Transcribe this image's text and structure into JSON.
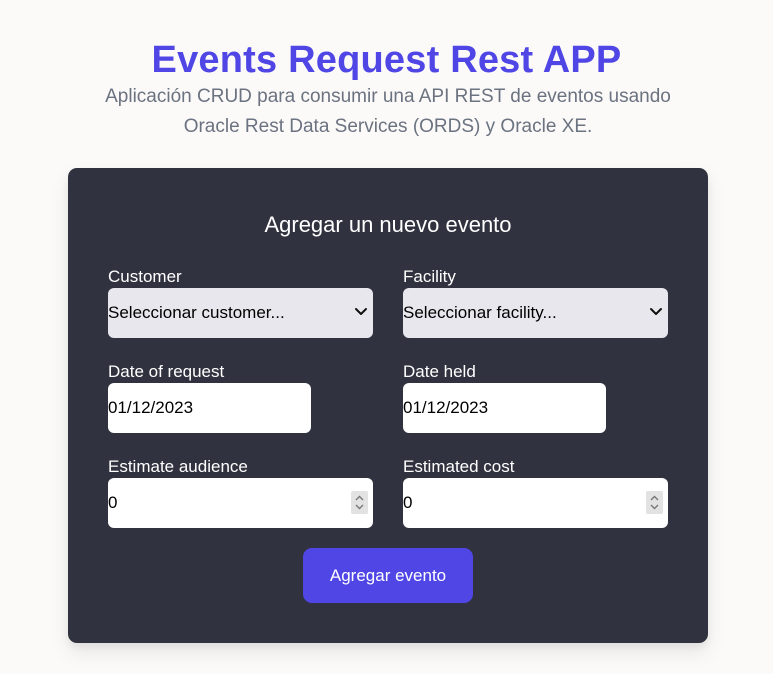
{
  "header": {
    "title": "Events Request Rest APP",
    "subtitle": "Aplicación CRUD para consumir una API REST de eventos usando Oracle Rest Data Services (ORDS) y Oracle XE."
  },
  "form": {
    "title": "Agregar un nuevo evento",
    "customer": {
      "label": "Customer",
      "value": "Seleccionar customer..."
    },
    "facility": {
      "label": "Facility",
      "value": "Seleccionar facility..."
    },
    "date_of_request": {
      "label": "Date of request",
      "value": "01/12/2023"
    },
    "date_held": {
      "label": "Date held",
      "value": "01/12/2023"
    },
    "estimate_audience": {
      "label": "Estimate audience",
      "value": "0"
    },
    "estimated_cost": {
      "label": "Estimated cost",
      "value": "0"
    },
    "submit_label": "Agregar evento"
  },
  "colors": {
    "accent": "#4f46e5",
    "card_background": "#30333f",
    "page_background": "#fbfaf9"
  },
  "icons": {
    "select_indicator": "chevron-down-icon",
    "number_spinner": "spinner-arrows-icon"
  }
}
